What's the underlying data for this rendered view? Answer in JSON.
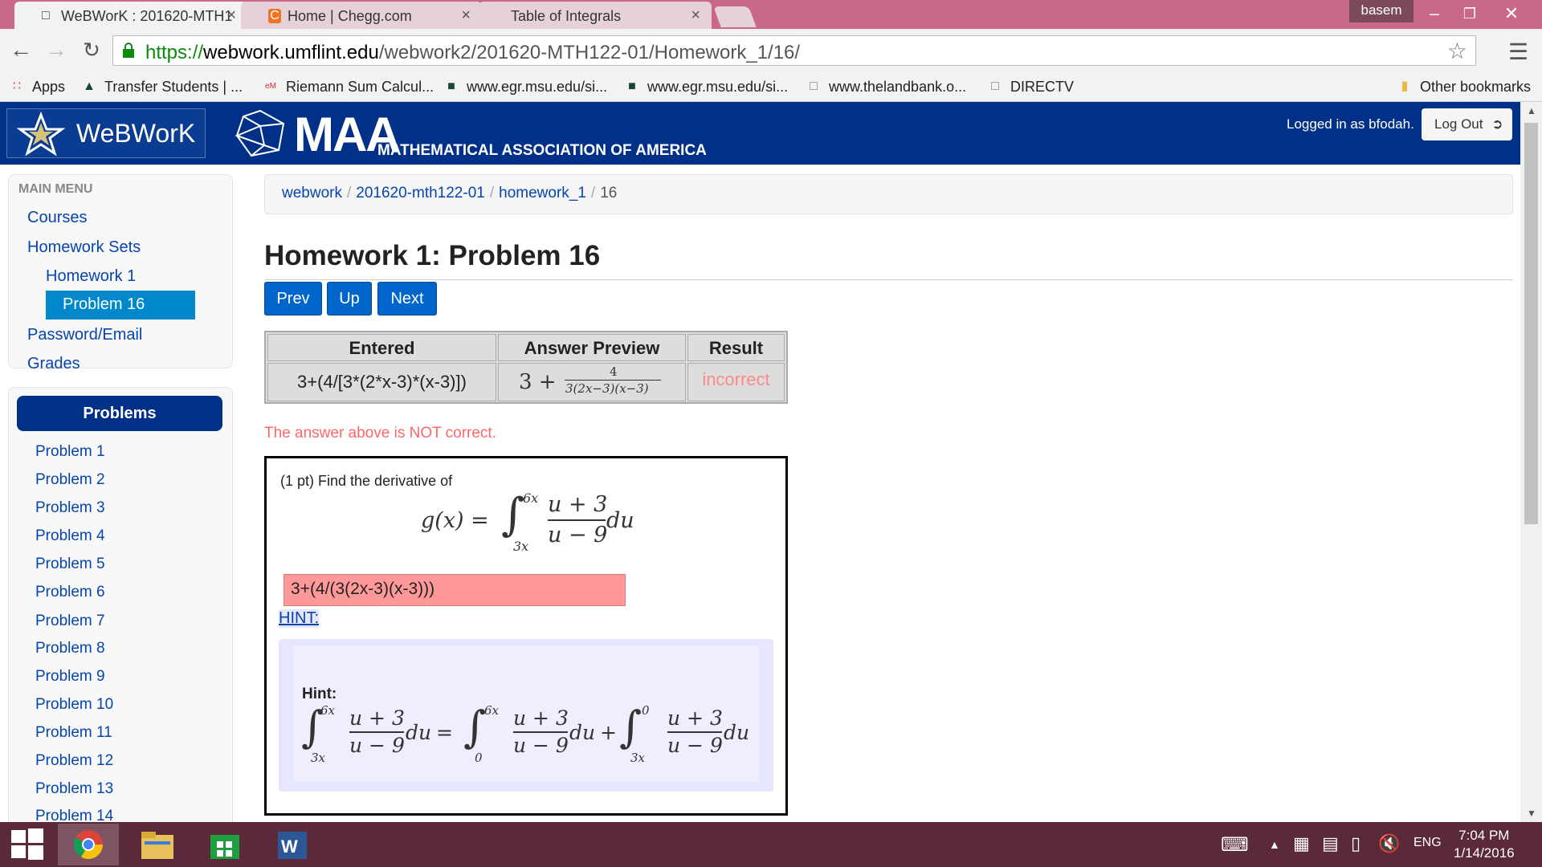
{
  "browser": {
    "tabs": [
      {
        "title": "WeBWorK : 201620-MTH1",
        "active": true
      },
      {
        "title": "Home | Chegg.com",
        "active": false
      },
      {
        "title": "Table of Integrals",
        "active": false
      }
    ],
    "user_badge": "basem",
    "url": {
      "scheme": "https://",
      "host": "webwork.umflint.edu",
      "path": "/webwork2/201620-MTH122-01/Homework_1/16/"
    },
    "bookmarks": [
      {
        "label": "Apps",
        "icon": "apps-grid-icon"
      },
      {
        "label": "Transfer Students | ...",
        "icon": "spartan-helmet-icon"
      },
      {
        "label": "Riemann Sum Calcul...",
        "icon": "emath-icon"
      },
      {
        "label": "www.egr.msu.edu/si...",
        "icon": "msu-building-icon"
      },
      {
        "label": "www.egr.msu.edu/si...",
        "icon": "msu-building-icon"
      },
      {
        "label": "www.thelandbank.o...",
        "icon": "page-icon"
      },
      {
        "label": "DIRECTV",
        "icon": "page-icon"
      }
    ],
    "other_bookmarks": "Other bookmarks"
  },
  "header": {
    "logo_text": "WeBWorK",
    "maa_text": "MAA",
    "maa_subtitle": "MATHEMATICAL ASSOCIATION OF AMERICA",
    "logged_in": "Logged in as bfodah.",
    "logout_label": "Log Out"
  },
  "sidebar": {
    "heading": "MAIN MENU",
    "courses": "Courses",
    "homework_sets": "Homework Sets",
    "homework_1": "Homework 1",
    "problem_active": "Problem 16",
    "password_email": "Password/Email",
    "grades": "Grades",
    "problems_header": "Problems",
    "problems": [
      "Problem 1",
      "Problem 2",
      "Problem 3",
      "Problem 4",
      "Problem 5",
      "Problem 6",
      "Problem 7",
      "Problem 8",
      "Problem 9",
      "Problem 10",
      "Problem 11",
      "Problem 12",
      "Problem 13",
      "Problem 14"
    ]
  },
  "main": {
    "breadcrumb": [
      "webwork",
      "201620-mth122-01",
      "homework_1",
      "16"
    ],
    "title": "Homework 1: Problem 16",
    "nav": {
      "prev": "Prev",
      "up": "Up",
      "next": "Next"
    },
    "results": {
      "headers": [
        "Entered",
        "Answer Preview",
        "Result"
      ],
      "entered": "3+(4/[3*(2*x-3)*(x-3)])",
      "preview_lead": "3 +",
      "preview_num": "4",
      "preview_den": "3(2x−3)(x−3)",
      "result": "incorrect"
    },
    "feedback": "The answer above is NOT correct.",
    "problem_text": "(1 pt) Find the derivative of",
    "formula": {
      "lhs": "g(x) =",
      "upper": "6x",
      "lower": "3x",
      "num": "u + 3",
      "den": "u − 9",
      "tail": "du"
    },
    "answer_value": "3+(4/(3(2x-3)(x-3)))",
    "hint_link": "HINT:",
    "hint_label": "Hint:",
    "hint_formula": {
      "a_upper": "6x",
      "a_lower": "3x",
      "b_upper": "6x",
      "b_lower": "0",
      "c_upper": "0",
      "c_lower": "3x",
      "num": "u + 3",
      "den": "u − 9",
      "du": "du",
      "eq": "=",
      "plus": "+"
    }
  },
  "taskbar": {
    "time": "7:04 PM",
    "date": "1/14/2016",
    "lang": "ENG"
  },
  "colors": {
    "brand": "#003087",
    "accent": "#0088cc",
    "incorrect": "#ff6666",
    "input_wrong": "#ff9999"
  }
}
